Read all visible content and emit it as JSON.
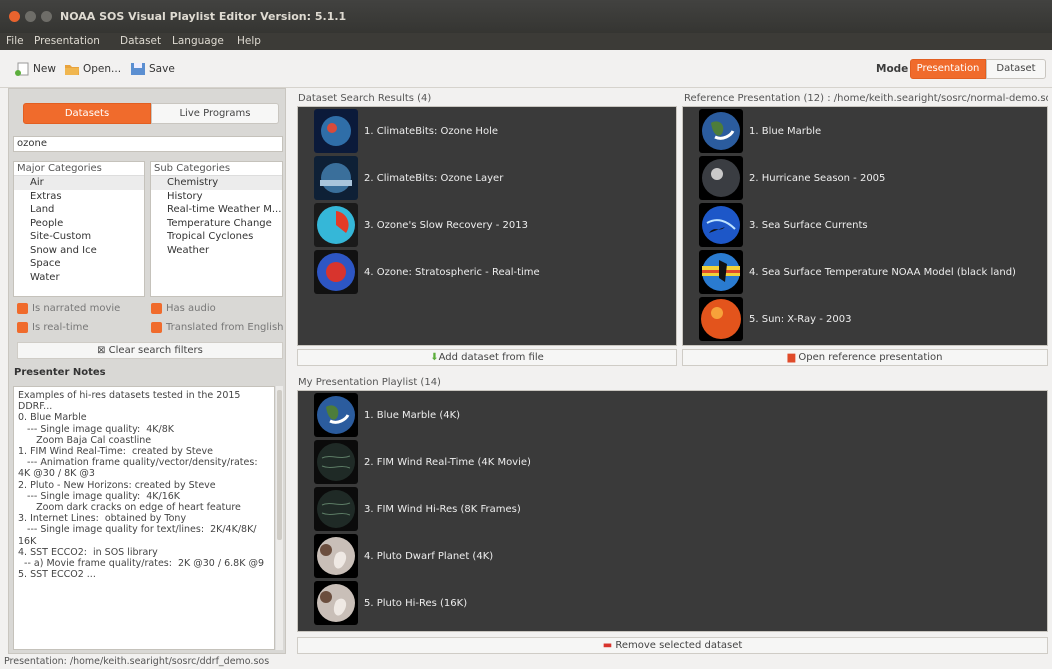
{
  "window": {
    "title": "NOAA SOS Visual Playlist Editor Version: 5.1.1"
  },
  "menu": [
    "File",
    "Presentation",
    "Dataset",
    "Language",
    "Help"
  ],
  "toolbar": {
    "new_label": "New",
    "open_label": "Open...",
    "save_label": "Save"
  },
  "mode": {
    "label": "Mode",
    "presentation": "Presentation",
    "dataset": "Dataset",
    "active": "Presentation"
  },
  "left": {
    "tabs": {
      "datasets": "Datasets",
      "live": "Live Programs",
      "active": "Datasets"
    },
    "search": {
      "value": "ozone"
    },
    "major": {
      "header": "Major Categories",
      "items": [
        "Air",
        "Extras",
        "Land",
        "People",
        "Site-Custom",
        "Snow and Ice",
        "Space",
        "Water"
      ],
      "selected": "Air"
    },
    "sub": {
      "header": "Sub Categories",
      "items": [
        "Chemistry",
        "History",
        "Real-time Weather M...",
        "Temperature Change",
        "Tropical Cyclones",
        "Weather"
      ],
      "selected": "Chemistry"
    },
    "filters": {
      "narrated": "Is narrated movie",
      "audio": "Has audio",
      "realtime": "Is real-time",
      "translated": "Translated from English"
    },
    "clear": "Clear search filters",
    "notes_title": "Presenter Notes",
    "notes": [
      "Examples of hi-res datasets tested in the 2015",
      "DDRF...",
      "0. Blue Marble",
      "   --- Single image quality:  4K/8K",
      "      Zoom Baja Cal coastline",
      "",
      "1. FIM Wind Real-Time:  created by Steve",
      "   --- Animation frame quality/vector/density/rates:",
      "4K @30 / 8K @3",
      "",
      "2. Pluto - New Horizons: created by Steve",
      "   --- Single image quality:  4K/16K",
      "      Zoom dark cracks on edge of heart feature",
      "",
      "3. Internet Lines:  obtained by Tony",
      "   --- Single image quality for text/lines:  2K/4K/8K/",
      "16K",
      "",
      "4. SST ECCO2:  in SOS library",
      "  -- a) Movie frame quality/rates:  2K @30 / 6.8K @9",
      "",
      "5. SST ECCO2 ..."
    ]
  },
  "search_results": {
    "title": "Dataset Search Results (4)",
    "items": [
      {
        "label": "1. ClimateBits: Ozone Hole",
        "thumb": "ozone-hole"
      },
      {
        "label": "2. ClimateBits: Ozone Layer",
        "thumb": "ozone-layer"
      },
      {
        "label": "3. Ozone's Slow Recovery - 2013",
        "thumb": "ozone-recovery"
      },
      {
        "label": "4. Ozone: Stratospheric - Real-time",
        "thumb": "ozone-strat"
      }
    ],
    "action": "Add dataset from file"
  },
  "reference": {
    "title": "Reference Presentation (12) : /home/keith.searight/sosrc/normal-demo.sos",
    "items": [
      {
        "label": "1. Blue Marble",
        "thumb": "blue-marble"
      },
      {
        "label": "2. Hurricane Season - 2005",
        "thumb": "hurricane"
      },
      {
        "label": "3. Sea Surface Currents",
        "thumb": "currents"
      },
      {
        "label": "4. Sea Surface Temperature NOAA Model (black land)",
        "thumb": "sst"
      },
      {
        "label": "5. Sun: X-Ray - 2003",
        "thumb": "sun"
      }
    ],
    "action": "Open reference presentation"
  },
  "playlist": {
    "title": "My Presentation Playlist (14)",
    "items": [
      {
        "label": "1. Blue Marble (4K)",
        "thumb": "blue-marble"
      },
      {
        "label": "2. FIM Wind Real-Time (4K Movie)",
        "thumb": "fim-wind"
      },
      {
        "label": "3. FIM Wind Hi-Res (8K Frames)",
        "thumb": "fim-wind"
      },
      {
        "label": "4. Pluto Dwarf Planet (4K)",
        "thumb": "pluto"
      },
      {
        "label": "5. Pluto Hi-Res (16K)",
        "thumb": "pluto"
      }
    ],
    "action": "Remove selected dataset"
  },
  "status": "Presentation: /home/keith.searight/sosrc/ddrf_demo.sos",
  "colors": {
    "accent": "#f06b2c",
    "panel_bg": "#3a3a3a",
    "titlebar": "#3c3b37"
  }
}
